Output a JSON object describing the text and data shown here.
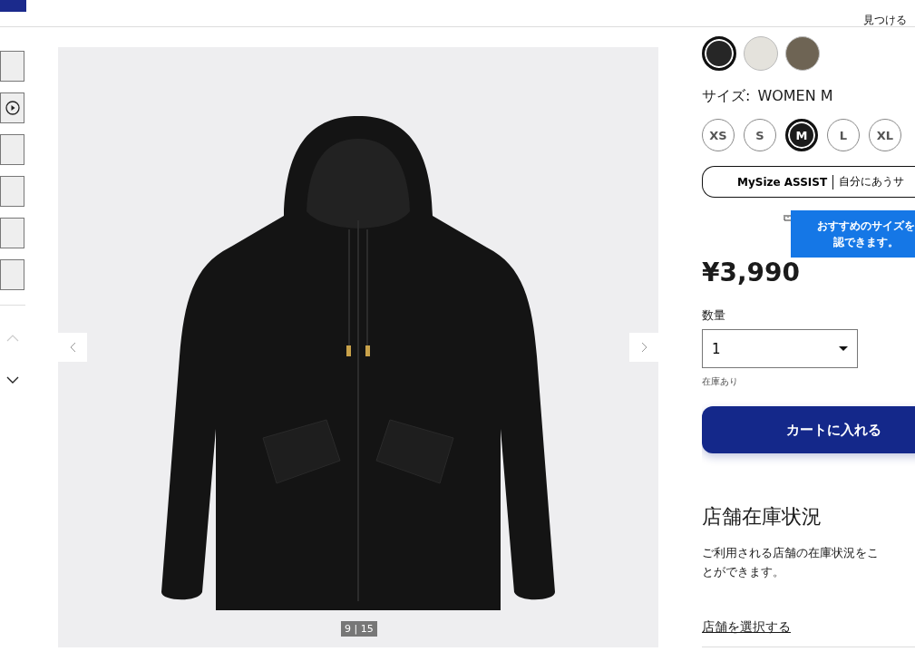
{
  "header": {
    "find_label": "見つける"
  },
  "thumbnails": [
    {
      "kind": "photo",
      "selected": false
    },
    {
      "kind": "video",
      "selected": false
    },
    {
      "kind": "photo",
      "selected": false
    },
    {
      "kind": "photo",
      "selected": false
    },
    {
      "kind": "photo",
      "selected": false
    },
    {
      "kind": "photo",
      "selected": false
    }
  ],
  "gallery": {
    "counter": "9 | 15"
  },
  "colors": [
    {
      "color": "#262626",
      "selected": true
    },
    {
      "color": "#e4e2dc",
      "selected": false
    },
    {
      "color": "#6e6454",
      "selected": false
    }
  ],
  "size_label": "サイズ:",
  "size_value": "WOMEN M",
  "sizes": [
    {
      "label": "XS",
      "selected": false
    },
    {
      "label": "S",
      "selected": false
    },
    {
      "label": "M",
      "selected": true
    },
    {
      "label": "L",
      "selected": false
    },
    {
      "label": "XL",
      "selected": false
    }
  ],
  "mysize": {
    "brand": "MySize ASSIST",
    "text": "自分にあうサ"
  },
  "tooltip": {
    "lines": [
      "おすすめのサイズを",
      "認できます。"
    ]
  },
  "price": "¥3,990",
  "quantity": {
    "label": "数量",
    "value": "1",
    "stock": "在庫あり"
  },
  "cart_button": "カートに入れる",
  "store": {
    "title": "店舗在庫状況",
    "description": "ご利用される店舗の在庫状況をこ",
    "description_2": "とができます。",
    "link": "店舗を選択する"
  }
}
